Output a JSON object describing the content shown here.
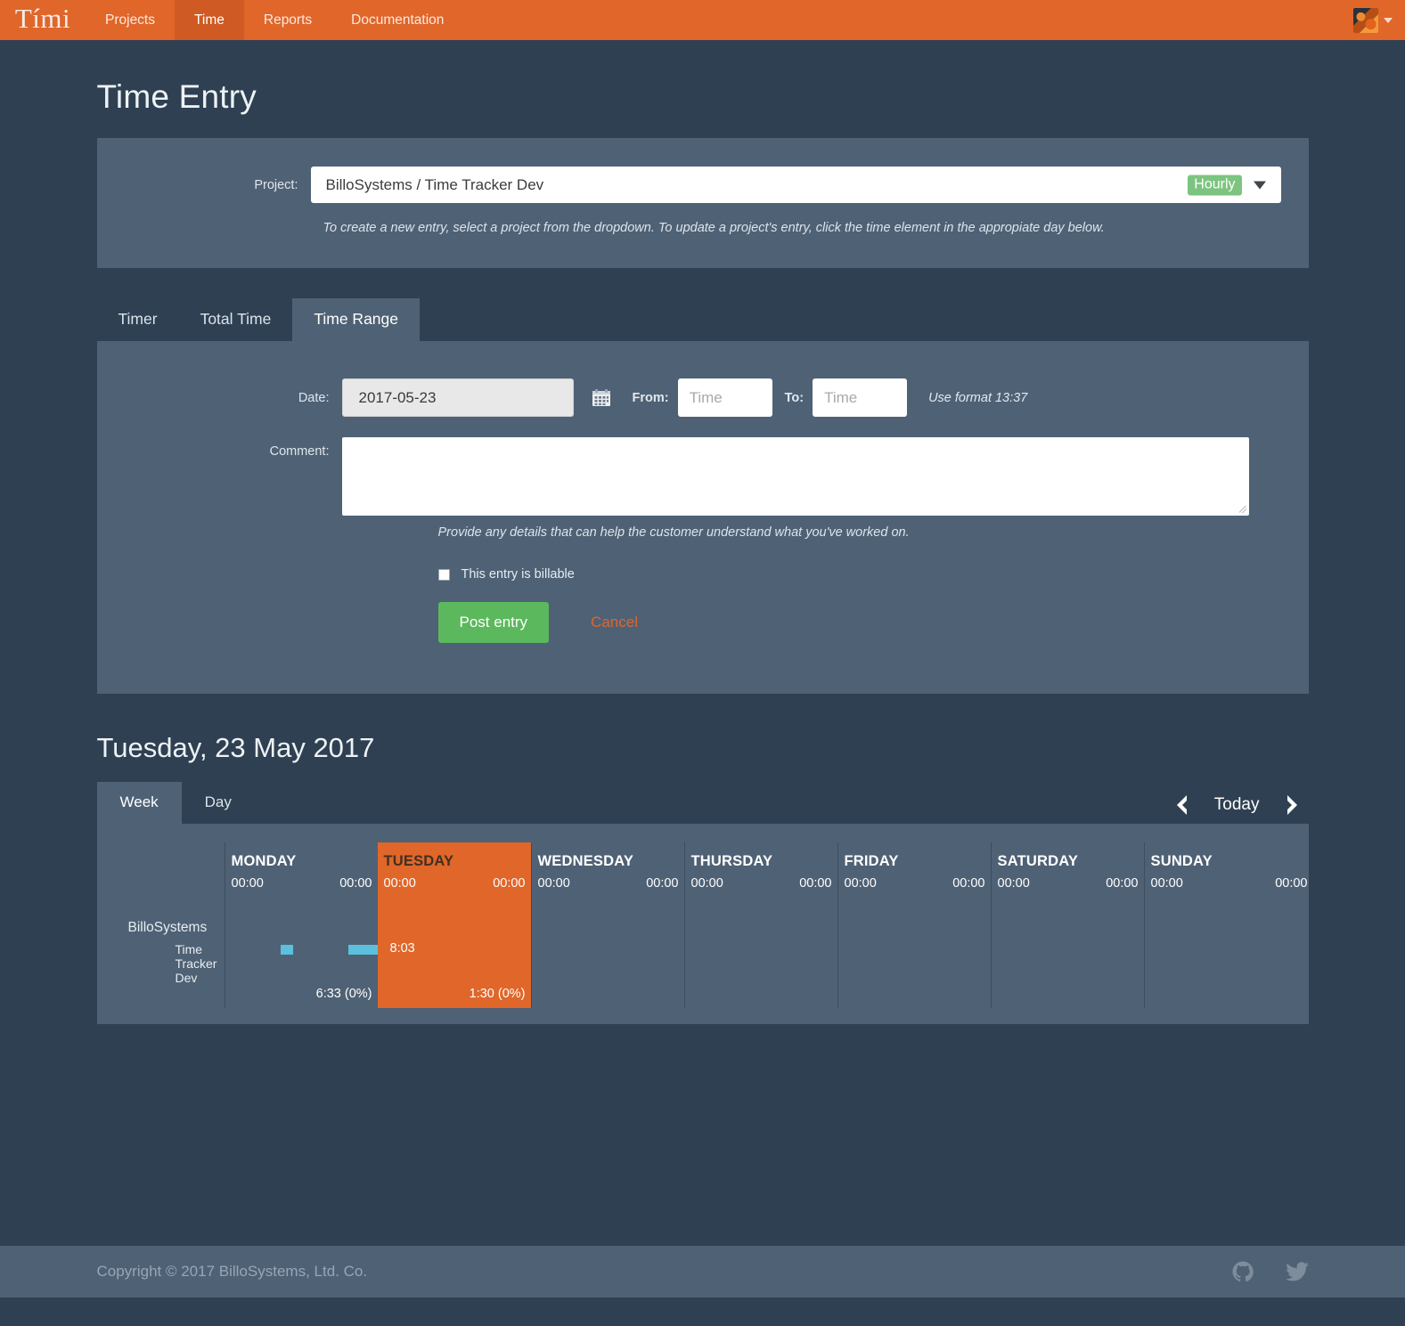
{
  "navbar": {
    "brand": "Tími",
    "items": [
      {
        "label": "Projects",
        "active": false
      },
      {
        "label": "Time",
        "active": true
      },
      {
        "label": "Reports",
        "active": false
      },
      {
        "label": "Documentation",
        "active": false
      }
    ],
    "avatar_icon": "user-avatar",
    "user_caret_icon": "caret-down-icon"
  },
  "page": {
    "title": "Time Entry"
  },
  "project_form": {
    "label": "Project:",
    "selected_project": "BilloSystems / Time Tracker Dev",
    "rate_badge": "Hourly",
    "rate_badge_color": "#7cc47f",
    "caret_icon": "caret-down-icon",
    "hint": "To create a new entry, select a project from the dropdown. To update a project's entry, click the time element in the appropiate day below."
  },
  "entry_tabs": [
    {
      "label": "Timer",
      "active": false
    },
    {
      "label": "Total Time",
      "active": false
    },
    {
      "label": "Time Range",
      "active": true
    }
  ],
  "time_range_form": {
    "date_label": "Date:",
    "date_value": "2017-05-23",
    "calendar_icon": "calendar-icon",
    "from_label": "From:",
    "from_placeholder": "Time",
    "from_value": "",
    "to_label": "To:",
    "to_placeholder": "Time",
    "to_value": "",
    "format_hint": "Use format 13:37",
    "comment_label": "Comment:",
    "comment_value": "",
    "comment_hint": "Provide any details that can help the customer understand what you've worked on.",
    "billable_label": "This entry is billable",
    "billable_checked": false,
    "post_label": "Post entry",
    "post_color": "#5cb85c",
    "cancel_label": "Cancel",
    "cancel_color": "#e0662a"
  },
  "calendar": {
    "heading": "Tuesday, 23 May 2017",
    "view_tabs": [
      {
        "label": "Week",
        "active": true
      },
      {
        "label": "Day",
        "active": false
      }
    ],
    "nav": {
      "prev_icon": "chevron-left-icon",
      "today_label": "Today",
      "next_icon": "chevron-right-icon"
    },
    "client": "BilloSystems",
    "project": "Time Tracker Dev",
    "project_color": "#5bc0de",
    "days": [
      {
        "name": "MONDAY",
        "left_hours": "00:00",
        "right_hours": "00:00",
        "total": "6:33 (0%)",
        "today": false,
        "bar_time": ""
      },
      {
        "name": "TUESDAY",
        "left_hours": "00:00",
        "right_hours": "00:00",
        "total": "1:30 (0%)",
        "today": true,
        "bar_time": "8:03"
      },
      {
        "name": "WEDNESDAY",
        "left_hours": "00:00",
        "right_hours": "00:00",
        "total": "",
        "today": false,
        "bar_time": ""
      },
      {
        "name": "THURSDAY",
        "left_hours": "00:00",
        "right_hours": "00:00",
        "total": "",
        "today": false,
        "bar_time": ""
      },
      {
        "name": "FRIDAY",
        "left_hours": "00:00",
        "right_hours": "00:00",
        "total": "",
        "today": false,
        "bar_time": ""
      },
      {
        "name": "SATURDAY",
        "left_hours": "00:00",
        "right_hours": "00:00",
        "total": "",
        "today": false,
        "bar_time": ""
      },
      {
        "name": "SUNDAY",
        "left_hours": "00:00",
        "right_hours": "00:00",
        "total": "",
        "today": false,
        "bar_time": ""
      }
    ]
  },
  "footer": {
    "copyright": "Copyright © 2017 BilloSystems, Ltd. Co.",
    "github_icon": "github-icon",
    "twitter_icon": "twitter-icon"
  }
}
